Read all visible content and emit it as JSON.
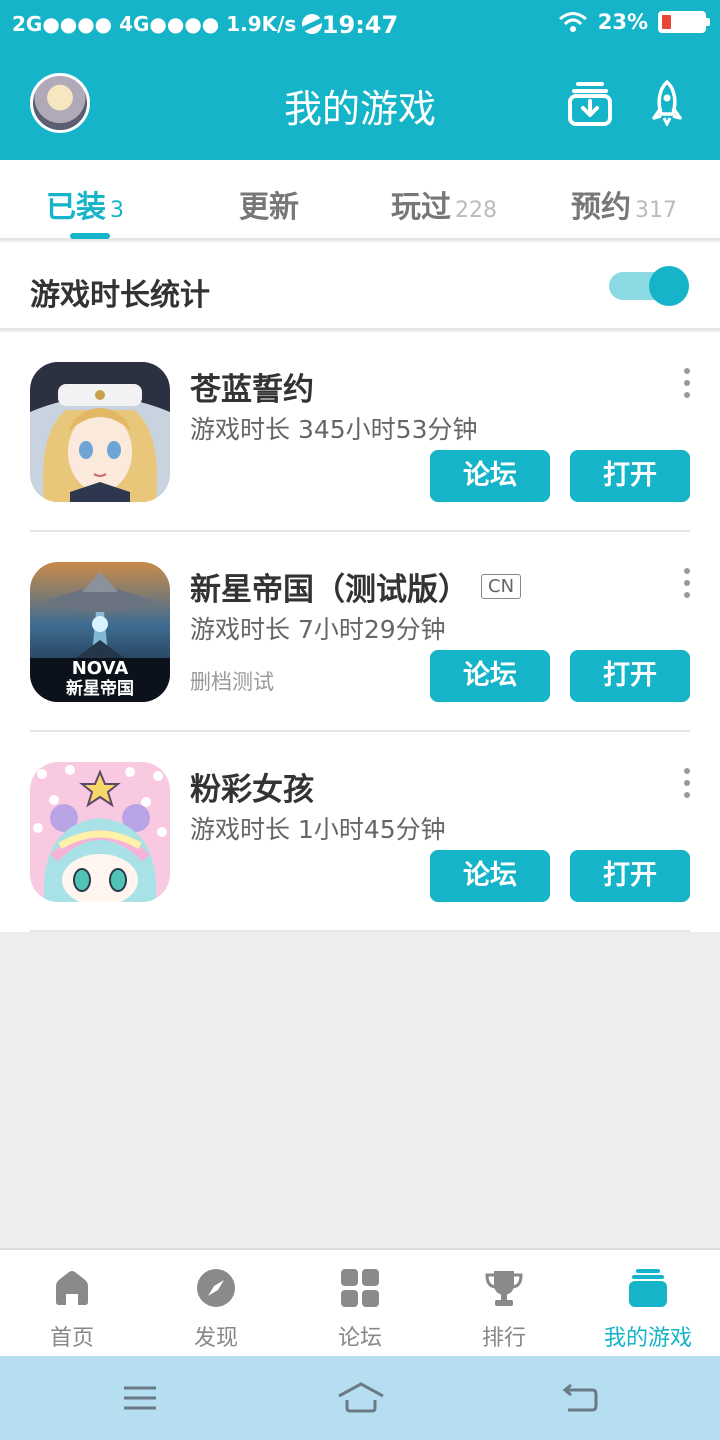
{
  "status_bar": {
    "network": "2G●●●● 4G●●●● 1.9K/s",
    "time": "19:47",
    "battery": "23%",
    "battery_level": 0.23
  },
  "header": {
    "title": "我的游戏",
    "avatar_icon": "user-avatar",
    "download_icon": "download-manager-icon",
    "rocket_icon": "rocket-icon"
  },
  "tabs": [
    {
      "label": "已装",
      "count": "3",
      "active": true
    },
    {
      "label": "更新",
      "count": ""
    },
    {
      "label": "玩过",
      "count": "228"
    },
    {
      "label": "预约",
      "count": "317"
    }
  ],
  "stats": {
    "label": "游戏时长统计",
    "enabled": true
  },
  "games": [
    {
      "name": "苍蓝誓约",
      "tag": "",
      "playtime": "游戏时长 345小时53分钟",
      "sub": "",
      "forum_label": "论坛",
      "open_label": "打开"
    },
    {
      "name": "新星帝国（测试版）",
      "tag": "CN",
      "playtime": "游戏时长 7小时29分钟",
      "sub": "删档测试",
      "forum_label": "论坛",
      "open_label": "打开",
      "icon_text_top": "NOVA",
      "icon_text_bottom": "新星帝国"
    },
    {
      "name": "粉彩女孩",
      "tag": "",
      "playtime": "游戏时长 1小时45分钟",
      "sub": "",
      "forum_label": "论坛",
      "open_label": "打开"
    }
  ],
  "bottom_nav": [
    {
      "label": "首页",
      "icon": "home-icon"
    },
    {
      "label": "发现",
      "icon": "compass-icon"
    },
    {
      "label": "论坛",
      "icon": "grid-icon"
    },
    {
      "label": "排行",
      "icon": "trophy-icon"
    },
    {
      "label": "我的游戏",
      "icon": "my-games-icon",
      "active": true
    }
  ],
  "colors": {
    "accent": "#16b4c8",
    "background": "#ededed",
    "system_nav": "#b5dff0"
  }
}
